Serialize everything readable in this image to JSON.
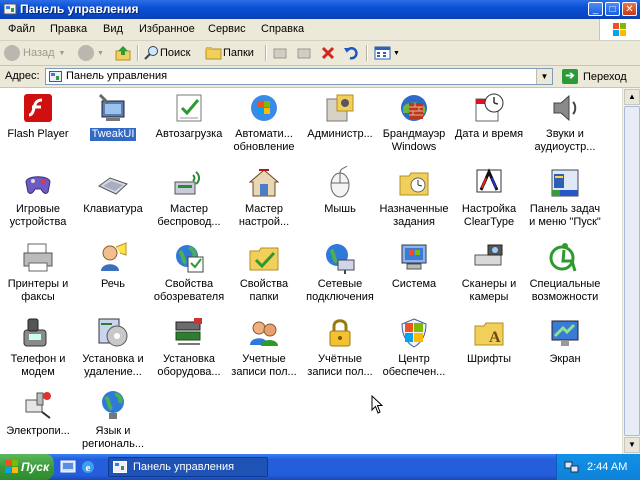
{
  "window": {
    "title": "Панель управления",
    "controls": {
      "minimize": "_",
      "maximize": "□",
      "close": "✕"
    }
  },
  "menu": [
    "Файл",
    "Правка",
    "Вид",
    "Избранное",
    "Сервис",
    "Справка"
  ],
  "toolbar": {
    "back": "Назад",
    "search": "Поиск",
    "folders": "Папки"
  },
  "address": {
    "label": "Адрес:",
    "value": "Панель управления",
    "go": "Переход"
  },
  "items": [
    {
      "label": "Flash Player",
      "icon": "flash-player-icon"
    },
    {
      "label": "TweakUI",
      "icon": "tweakui-icon",
      "selected": true
    },
    {
      "label": "Автозагрузка",
      "icon": "autorun-icon"
    },
    {
      "label": "Автомати...\nобновление",
      "icon": "windows-update-icon"
    },
    {
      "label": "Администр...",
      "icon": "admin-tools-icon"
    },
    {
      "label": "Брандмауэр\nWindows",
      "icon": "firewall-icon"
    },
    {
      "label": "Дата и время",
      "icon": "date-time-icon"
    },
    {
      "label": "Звуки и\nаудиоустр...",
      "icon": "sound-icon"
    },
    {
      "label": "Игровые\nустройства",
      "icon": "gamepad-icon"
    },
    {
      "label": "Клавиатура",
      "icon": "keyboard-icon"
    },
    {
      "label": "Мастер\nбеспровод...",
      "icon": "wireless-wizard-icon"
    },
    {
      "label": "Мастер\nнастрой...",
      "icon": "network-wizard-icon"
    },
    {
      "label": "Мышь",
      "icon": "mouse-icon"
    },
    {
      "label": "Назначенные\nзадания",
      "icon": "scheduled-tasks-icon"
    },
    {
      "label": "Настройка\nClearType",
      "icon": "cleartype-icon"
    },
    {
      "label": "Панель задач\nи меню \"Пуск\"",
      "icon": "taskbar-icon"
    },
    {
      "label": "Принтеры и\nфаксы",
      "icon": "printer-icon"
    },
    {
      "label": "Речь",
      "icon": "speech-icon"
    },
    {
      "label": "Свойства\nобозревателя",
      "icon": "internet-options-icon"
    },
    {
      "label": "Свойства\nпапки",
      "icon": "folder-options-icon"
    },
    {
      "label": "Сетевые\nподключения",
      "icon": "network-connections-icon"
    },
    {
      "label": "Система",
      "icon": "system-icon"
    },
    {
      "label": "Сканеры и\nкамеры",
      "icon": "scanner-icon"
    },
    {
      "label": "Специальные\nвозможности",
      "icon": "accessibility-icon"
    },
    {
      "label": "Телефон и\nмодем",
      "icon": "phone-modem-icon"
    },
    {
      "label": "Установка и\nудаление...",
      "icon": "add-remove-icon"
    },
    {
      "label": "Установка\nоборудова...",
      "icon": "add-hardware-icon"
    },
    {
      "label": "Учетные\nзаписи пол...",
      "icon": "user-accounts-icon"
    },
    {
      "label": "Учётные\nзаписи пол...",
      "icon": "user-accounts-lock-icon"
    },
    {
      "label": "Центр\nобеспечен...",
      "icon": "security-center-icon"
    },
    {
      "label": "Шрифты",
      "icon": "fonts-icon"
    },
    {
      "label": "Экран",
      "icon": "display-icon"
    },
    {
      "label": "Электропи...",
      "icon": "power-icon"
    },
    {
      "label": "Язык и\nрегиональ...",
      "icon": "regional-icon"
    }
  ],
  "taskbar": {
    "start": "Пуск",
    "task": "Панель управления",
    "clock": "2:44 AM"
  }
}
